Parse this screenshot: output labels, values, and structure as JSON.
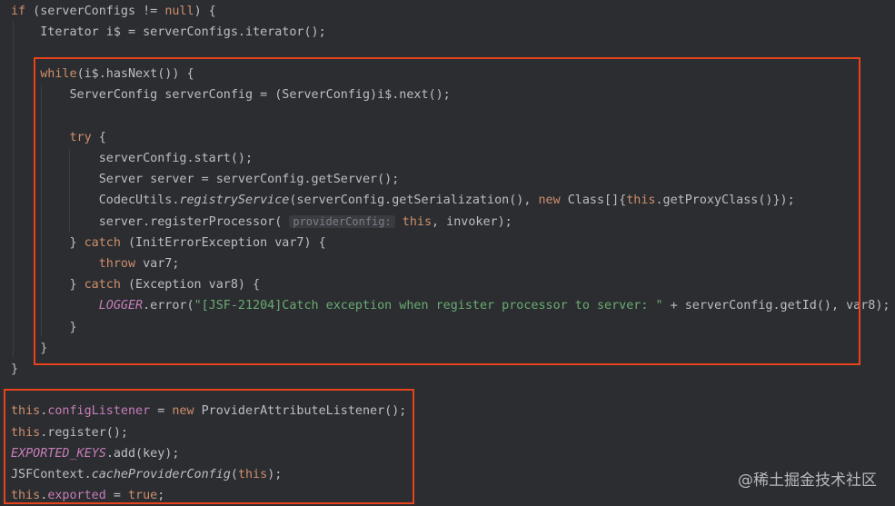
{
  "editor": {
    "lines": [
      [
        {
          "t": "if",
          "c": "kw"
        },
        {
          "t": " (serverConfigs != "
        },
        {
          "t": "null",
          "c": "kw"
        },
        {
          "t": ") {"
        }
      ],
      [
        {
          "t": "    Iterator i$ = serverConfigs.iterator();"
        }
      ],
      [],
      [
        {
          "t": "    "
        },
        {
          "t": "while",
          "c": "kw"
        },
        {
          "t": "(i$.hasNext()) {"
        }
      ],
      [
        {
          "t": "        ServerConfig serverConfig = (ServerConfig)i$.next();"
        }
      ],
      [],
      [
        {
          "t": "        "
        },
        {
          "t": "try",
          "c": "kw"
        },
        {
          "t": " {"
        }
      ],
      [
        {
          "t": "            serverConfig.start();"
        }
      ],
      [
        {
          "t": "            Server server = serverConfig.getServer();"
        }
      ],
      [
        {
          "t": "            CodecUtils."
        },
        {
          "t": "registryService",
          "c": "ital"
        },
        {
          "t": "(serverConfig.getSerialization(), "
        },
        {
          "t": "new",
          "c": "kw"
        },
        {
          "t": " Class[]{"
        },
        {
          "t": "this",
          "c": "kw"
        },
        {
          "t": ".getProxyClass()});"
        }
      ],
      [
        {
          "t": "            server.registerProcessor( "
        },
        {
          "t": "providerConfig:",
          "c": "hint"
        },
        {
          "t": " "
        },
        {
          "t": "this",
          "c": "kw"
        },
        {
          "t": ", invoker);"
        }
      ],
      [
        {
          "t": "        } "
        },
        {
          "t": "catch",
          "c": "kw"
        },
        {
          "t": " (InitErrorException var7) {"
        }
      ],
      [
        {
          "t": "            "
        },
        {
          "t": "throw",
          "c": "kw"
        },
        {
          "t": " var7;"
        }
      ],
      [
        {
          "t": "        } "
        },
        {
          "t": "catch",
          "c": "kw"
        },
        {
          "t": " (Exception var8) {"
        }
      ],
      [
        {
          "t": "            "
        },
        {
          "t": "LOGGER",
          "c": "stat"
        },
        {
          "t": ".error("
        },
        {
          "t": "\"[JSF-21204]Catch exception when register processor to server: \"",
          "c": "str"
        },
        {
          "t": " + serverConfig.getId(), var8);"
        }
      ],
      [
        {
          "t": "        }"
        }
      ],
      [
        {
          "t": "    }"
        }
      ],
      [
        {
          "t": "}"
        }
      ],
      [],
      [
        {
          "t": "this",
          "c": "kw"
        },
        {
          "t": "."
        },
        {
          "t": "configListener",
          "c": "fld"
        },
        {
          "t": " = "
        },
        {
          "t": "new",
          "c": "kw"
        },
        {
          "t": " ProviderAttributeListener();"
        }
      ],
      [
        {
          "t": "this",
          "c": "kw"
        },
        {
          "t": ".register();"
        }
      ],
      [
        {
          "t": "EXPORTED_KEYS",
          "c": "stat"
        },
        {
          "t": ".add(key);"
        }
      ],
      [
        {
          "t": "JSFContext."
        },
        {
          "t": "cacheProviderConfig",
          "c": "ital"
        },
        {
          "t": "("
        },
        {
          "t": "this",
          "c": "kw"
        },
        {
          "t": ");"
        }
      ],
      [
        {
          "t": "this",
          "c": "kw"
        },
        {
          "t": "."
        },
        {
          "t": "exported",
          "c": "fld"
        },
        {
          "t": " = "
        },
        {
          "t": "true",
          "c": "kw"
        },
        {
          "t": ";"
        }
      ]
    ]
  },
  "colors": {
    "background": "#2b2d30",
    "keyword": "#cf8e6d",
    "field": "#c77dbb",
    "string": "#6aab73",
    "highlight_box": "#e8441b"
  },
  "watermark": {
    "text": "@稀土掘金技术社区"
  }
}
